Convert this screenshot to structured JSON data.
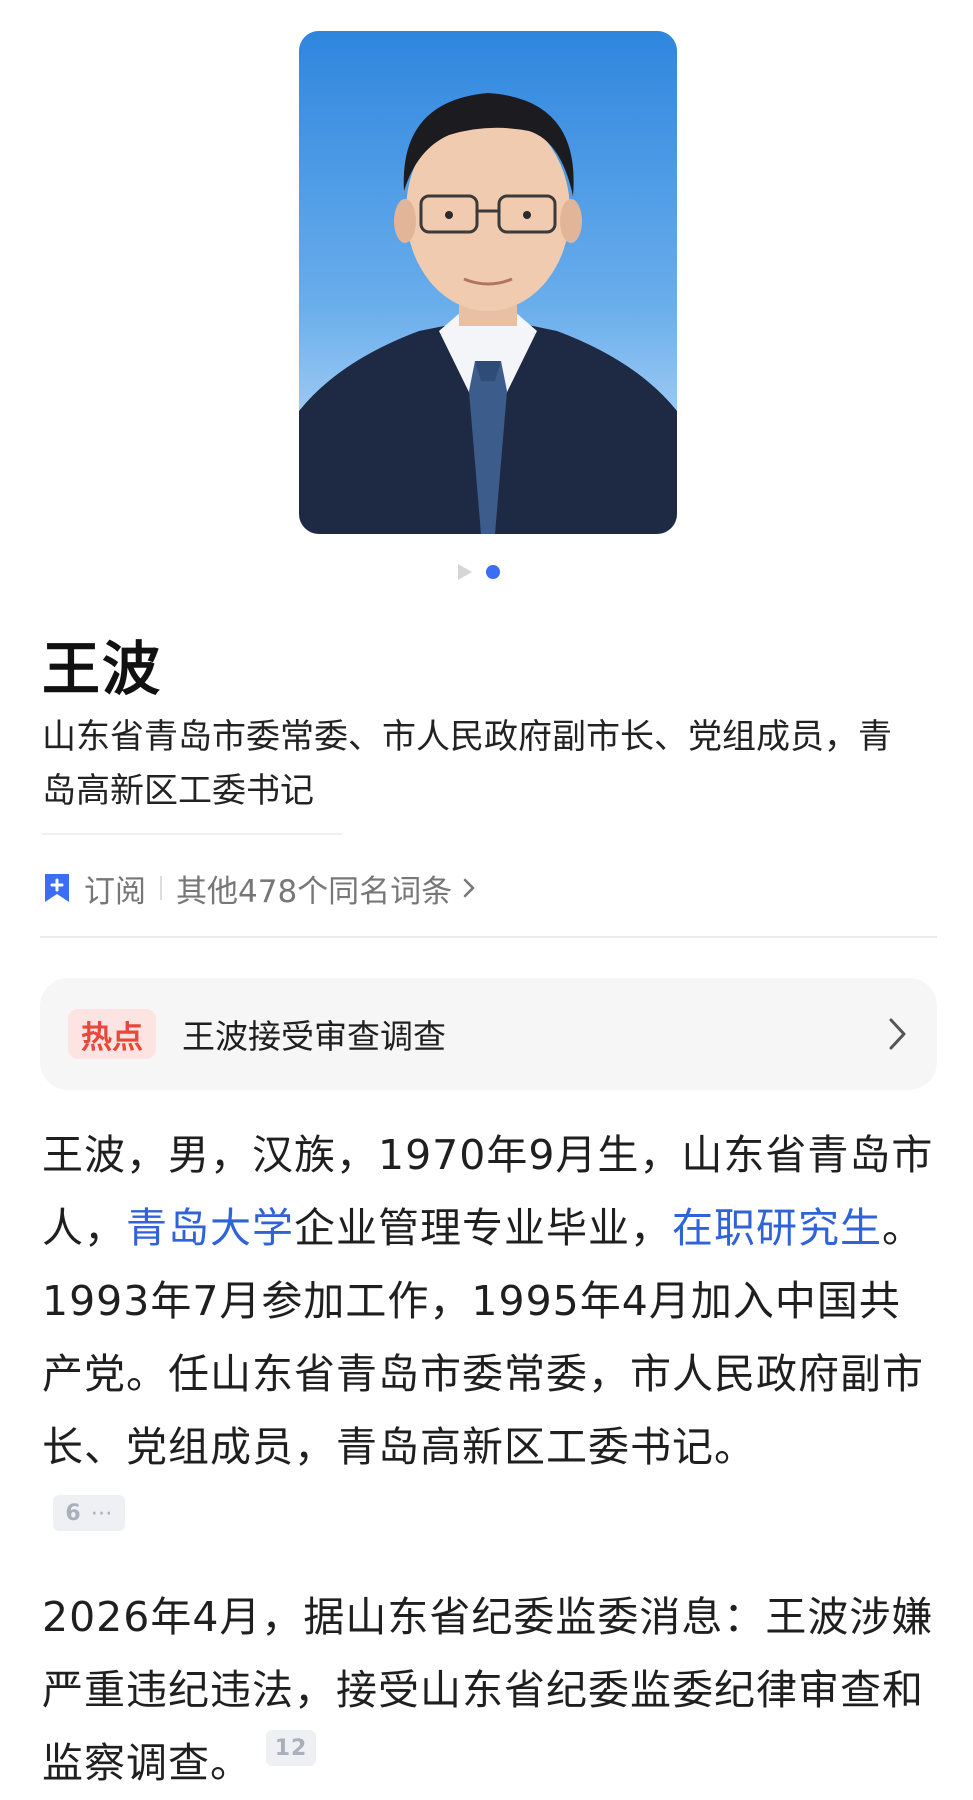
{
  "header": {
    "title": "王波",
    "subtitle": "山东省青岛市委常委、市人民政府副市长、党组成员，青岛高新区工委书记"
  },
  "subscribe": {
    "label": "订阅",
    "others": "其他478个同名词条"
  },
  "hot": {
    "badge": "热点",
    "text": "王波接受审查调查"
  },
  "bio": {
    "p1_a": "王波，男，汉族，1970年9月生，山东省青岛市人，",
    "p1_link1": "青岛大学",
    "p1_b": "企业管理专业毕业，",
    "p1_link2": "在职研究生",
    "p1_c": "。1993年7月参加工作，1995年4月加入中国共产党。任山东省青岛市委常委，市人民政府副市长、党组成员，青岛高新区工委书记。",
    "p1_ref": "6",
    "p1_ref_more": "⋯",
    "p2": "2026年4月，据山东省纪委监委消息：王波涉嫌严重违纪违法，接受山东省纪委监委纪律审查和监察调查。",
    "p2_ref": "12"
  },
  "colors": {
    "accent": "#3b6ef5",
    "link": "#2f63d7",
    "hot_badge": "#e8483b"
  }
}
